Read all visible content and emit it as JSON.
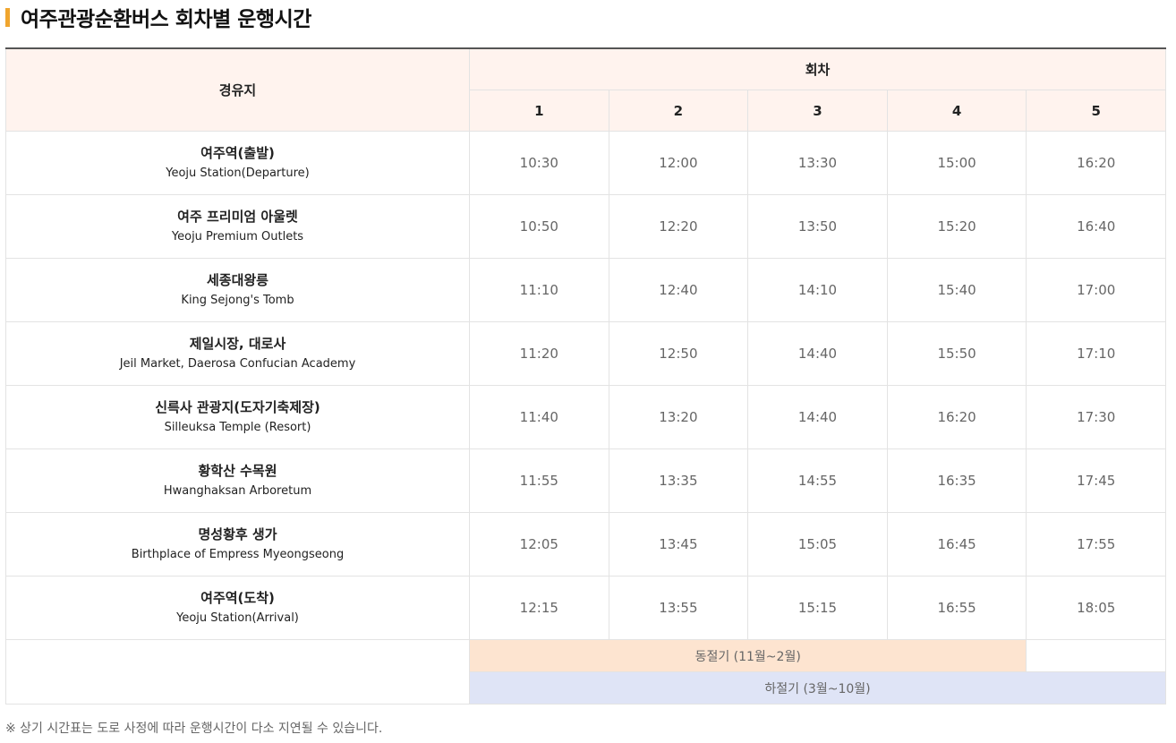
{
  "title": "여주관광순환버스 회차별 운행시간",
  "table": {
    "route_header": "경유지",
    "trip_header": "회차",
    "trips": [
      "1",
      "2",
      "3",
      "4",
      "5"
    ],
    "stops": [
      {
        "ko": "여주역(출발)",
        "en": "Yeoju Station(Departure)",
        "times": [
          "10:30",
          "12:00",
          "13:30",
          "15:00",
          "16:20"
        ]
      },
      {
        "ko": "여주 프리미엄 아울렛",
        "en": "Yeoju Premium Outlets",
        "times": [
          "10:50",
          "12:20",
          "13:50",
          "15:20",
          "16:40"
        ]
      },
      {
        "ko": "세종대왕릉",
        "en": "King Sejong's Tomb",
        "times": [
          "11:10",
          "12:40",
          "14:10",
          "15:40",
          "17:00"
        ]
      },
      {
        "ko": "제일시장, 대로사",
        "en": "Jeil Market, Daerosa Confucian Academy",
        "times": [
          "11:20",
          "12:50",
          "14:40",
          "15:50",
          "17:10"
        ]
      },
      {
        "ko": "신륵사 관광지(도자기축제장)",
        "en": "Silleuksa Temple (Resort)",
        "times": [
          "11:40",
          "13:20",
          "14:40",
          "16:20",
          "17:30"
        ]
      },
      {
        "ko": "황학산 수목원",
        "en": "Hwanghaksan Arboretum",
        "times": [
          "11:55",
          "13:35",
          "14:55",
          "16:35",
          "17:45"
        ]
      },
      {
        "ko": "명성황후 생가",
        "en": "Birthplace of Empress Myeongseong",
        "times": [
          "12:05",
          "13:45",
          "15:05",
          "16:45",
          "17:55"
        ]
      },
      {
        "ko": "여주역(도착)",
        "en": "Yeoju Station(Arrival)",
        "times": [
          "12:15",
          "13:55",
          "15:15",
          "16:55",
          "18:05"
        ]
      }
    ],
    "legend": {
      "winter": "동절기 (11월~2월)",
      "summer": "하절기 (3월~10월)",
      "winter_color": "#fde4d0",
      "summer_color": "#dfe4f6"
    }
  },
  "note": "※ 상기 시간표는 도로 사정에 따라 운행시간이 다소 지연될 수 있습니다.",
  "colors": {
    "accent": "#f0a52e",
    "header_bg": "#fff3ee"
  }
}
